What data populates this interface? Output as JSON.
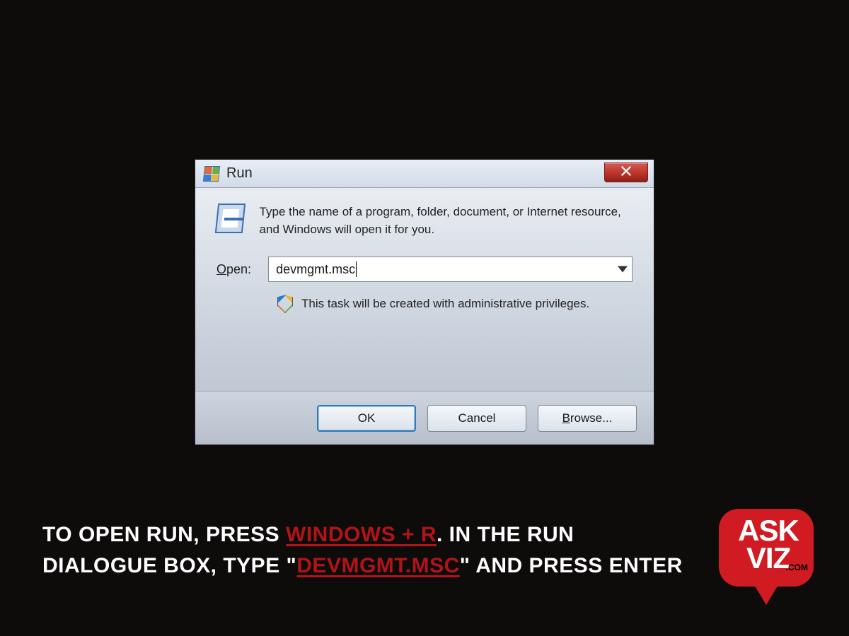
{
  "run_dialog": {
    "title": "Run",
    "description": "Type the name of a program, folder, document, or Internet resource, and Windows will open it for you.",
    "open_label_prefix": "O",
    "open_label_rest": "pen:",
    "input_value": "devmgmt.msc",
    "admin_notice": "This task will be created with administrative privileges.",
    "buttons": {
      "ok": "OK",
      "cancel": "Cancel",
      "browse_prefix": "B",
      "browse_rest": "rowse..."
    }
  },
  "caption": {
    "seg1": "TO OPEN RUN, PRESS ",
    "hl1": "WINDOWS + R",
    "seg2": ". IN THE RUN DIALOGUE BOX, TYPE \"",
    "hl2": "DEVMGMT.MSC",
    "seg3": "\" AND PRESS ENTER"
  },
  "logo": {
    "line1": "ASK",
    "line2": "VIZ",
    "suffix": ".COM"
  }
}
